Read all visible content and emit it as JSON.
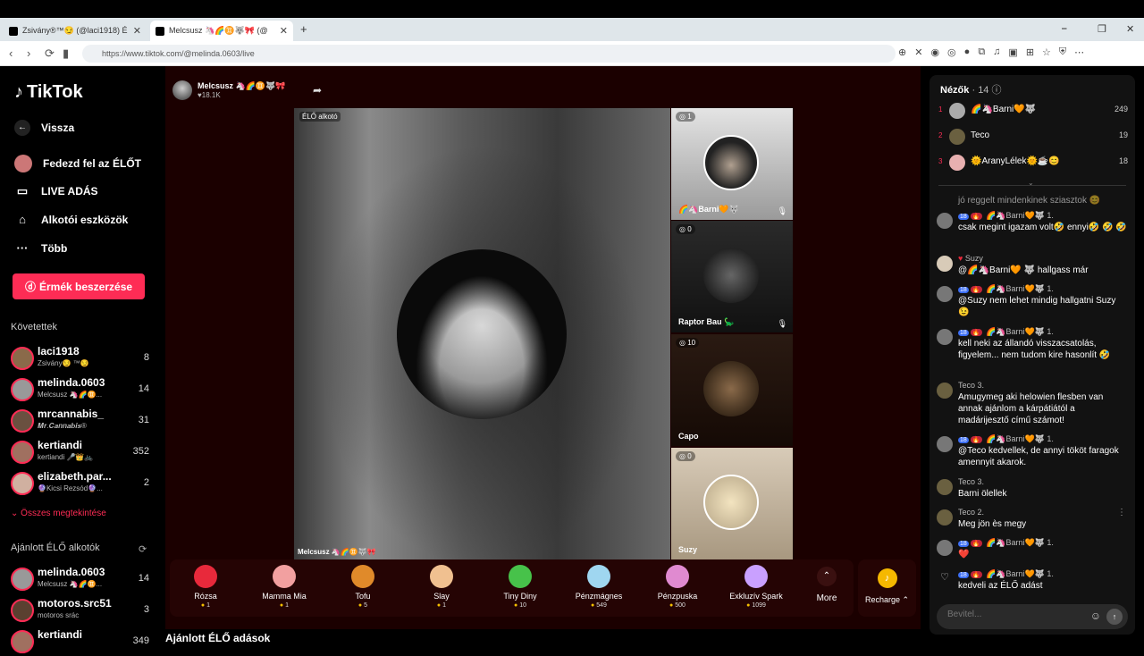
{
  "browser": {
    "tabs": [
      {
        "title": "Zsivány®™😏 (@laci1918) ÉLŐ a"
      },
      {
        "title": "Melcsusz 🦄🌈♊🐺🎀 (@"
      }
    ],
    "new_tab": "+",
    "url": "https://www.tiktok.com/@melinda.0603/live",
    "win_controls": [
      "⎯",
      "❐",
      "✕"
    ]
  },
  "sidebar": {
    "logo": "TikTok",
    "back": "Vissza",
    "nav": [
      {
        "label": "Fedezd fel az ÉLŐT",
        "icon": "explore-icon"
      },
      {
        "label": "LIVE ADÁS",
        "icon": "video-icon"
      },
      {
        "label": "Alkotói eszközök",
        "icon": "house-icon"
      },
      {
        "label": "Több",
        "icon": "more-icon"
      }
    ],
    "coins_button": "Érmék beszerzése",
    "following_title": "Követettek",
    "following": [
      {
        "name": "laci1918",
        "sub": "Zsivány😏 ™😏",
        "count": "8"
      },
      {
        "name": "melinda.0603",
        "sub": "Melcsusz 🦄🌈♊...",
        "count": "14"
      },
      {
        "name": "mrcannabis_",
        "sub": "𝑴𝒓.𝑪𝒂𝒏𝒏𝒂𝒃𝒊𝒔®",
        "count": "31"
      },
      {
        "name": "kertiandi",
        "sub": "kertiandi 🎤👑🚲",
        "count": "352"
      },
      {
        "name": "elizabeth.par...",
        "sub": "🔮Kicsi Rezsód🔮...",
        "count": "2"
      }
    ],
    "see_all": "Összes megtekintése",
    "recommended_title": "Ajánlott ÉLŐ alkotók",
    "recommended": [
      {
        "name": "melinda.0603",
        "sub": "Melcsusz 🦄🌈♊...",
        "count": "14"
      },
      {
        "name": "motoros.src51",
        "sub": "motoros srác",
        "count": "3"
      },
      {
        "name": "kertiandi",
        "sub": "",
        "count": "349"
      }
    ]
  },
  "stage": {
    "host_name": "Melcsusz 🦄🌈♊🐺🎀",
    "host_likes": "♥18.1K",
    "live_tag": "ÉLŐ alkotó",
    "host_label": "Melcsusz 🦄🌈♊🐺🎀",
    "guests": [
      {
        "badge": "1",
        "name": "🌈🦄Barni🧡🐺"
      },
      {
        "badge": "0",
        "name": "Raptor Bau 🦕"
      },
      {
        "badge": "10",
        "name": "Capo"
      },
      {
        "badge": "0",
        "name": "Suzy"
      }
    ]
  },
  "gifts": [
    {
      "name": "Rózsa",
      "price": "1",
      "color": "#e8293b"
    },
    {
      "name": "Mamma Mia",
      "price": "1",
      "color": "#f2a0a0"
    },
    {
      "name": "Tofu",
      "price": "5",
      "color": "#e08a2a"
    },
    {
      "name": "Slay",
      "price": "1",
      "color": "#f0c090"
    },
    {
      "name": "Tiny Diny",
      "price": "10",
      "color": "#47c24a"
    },
    {
      "name": "Pénzmágnes",
      "price": "549",
      "color": "#9fd6f0"
    },
    {
      "name": "Pénzpuska",
      "price": "500",
      "color": "#e08ad0"
    },
    {
      "name": "Exkluzív Spark",
      "price": "1099",
      "color": "#c9a0ff"
    }
  ],
  "more_label": "More",
  "recharge_label": "Recharge ⌃",
  "suggested_title": "Ajánlott ÉLŐ adások",
  "viewers": {
    "title": "Nézők",
    "count": "· 14 ⓘ",
    "top": [
      {
        "rank": "1",
        "name": "🌈🦄Barni🧡🐺",
        "score": "249"
      },
      {
        "rank": "2",
        "name": "Teco",
        "score": "19"
      },
      {
        "rank": "3",
        "name": "🌞AranyLélek🌞☕😊",
        "score": "18"
      }
    ]
  },
  "chat": [
    {
      "head": "",
      "text": "jó reggelt mindenkinek sziasztok 😊"
    },
    {
      "head": "🌈🦄Barni🧡🐺 1.",
      "badges": [
        "18",
        "🔥"
      ],
      "text": "csak megint igazam volt🤣 ennyi🤣 🤣 🤣"
    },
    {
      "head": "Suzy",
      "badges": [],
      "text": "@🌈🦄Barni🧡 🐺 hallgass már"
    },
    {
      "head": "🌈🦄Barni🧡🐺 1.",
      "badges": [
        "18",
        "🔥"
      ],
      "text": "@Suzy nem lehet mindig hallgatni Suzy 😉"
    },
    {
      "head": "🌈🦄Barni🧡🐺 1.",
      "badges": [
        "18",
        "🔥"
      ],
      "text": "kell neki az állandó visszacsatolás, figyelem... nem tudom kire hasonlít 🤣"
    },
    {
      "head": "Teco 3.",
      "badges": [],
      "text": "Amugymeg aki helowien flesben van annak ajánlom a kárpátiától a madárijesztő című számot!"
    },
    {
      "head": "🌈🦄Barni🧡🐺 1.",
      "badges": [
        "18",
        "🔥"
      ],
      "text": "@Teco kedvellek, de annyi tököt faragok amennyit akarok."
    },
    {
      "head": "Teco 3.",
      "badges": [],
      "text": "Barni ölellek"
    },
    {
      "head": "Teco 2.",
      "badges": [],
      "text": "Meg jön ès megy"
    },
    {
      "head": "🌈🦄Barni🧡🐺 1.",
      "badges": [
        "18",
        "🔥"
      ],
      "text": "❤️"
    },
    {
      "head": "🌈🦄Barni🧡🐺 1.",
      "badges": [
        "18",
        "🔥"
      ],
      "text": "kedveli az ÉLŐ adást"
    }
  ],
  "chat_input": {
    "placeholder": "Bevitel..."
  }
}
